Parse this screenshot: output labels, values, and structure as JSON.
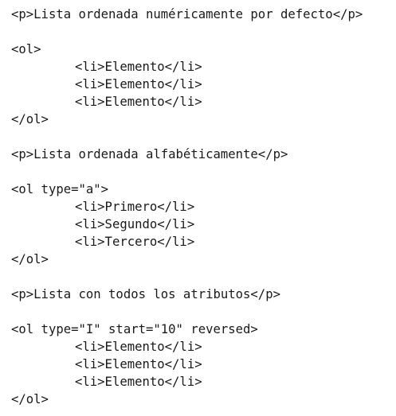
{
  "lines": [
    {
      "text": "<p>Lista ordenada numéricamente por defecto</p>",
      "indent": false
    },
    {
      "text": "",
      "indent": false
    },
    {
      "text": "<ol>",
      "indent": false
    },
    {
      "text": "<li>Elemento</li>",
      "indent": true
    },
    {
      "text": "<li>Elemento</li>",
      "indent": true
    },
    {
      "text": "<li>Elemento</li>",
      "indent": true
    },
    {
      "text": "</ol>",
      "indent": false
    },
    {
      "text": "",
      "indent": false
    },
    {
      "text": "<p>Lista ordenada alfabéticamente</p>",
      "indent": false
    },
    {
      "text": "",
      "indent": false
    },
    {
      "text": "<ol type=\"a\">",
      "indent": false
    },
    {
      "text": "<li>Primero</li>",
      "indent": true
    },
    {
      "text": "<li>Segundo</li>",
      "indent": true
    },
    {
      "text": "<li>Tercero</li>",
      "indent": true
    },
    {
      "text": "</ol>",
      "indent": false
    },
    {
      "text": "",
      "indent": false
    },
    {
      "text": "<p>Lista con todos los atributos</p>",
      "indent": false
    },
    {
      "text": "",
      "indent": false
    },
    {
      "text": "<ol type=\"I\" start=\"10\" reversed>",
      "indent": false
    },
    {
      "text": "<li>Elemento</li>",
      "indent": true
    },
    {
      "text": "<li>Elemento</li>",
      "indent": true
    },
    {
      "text": "<li>Elemento</li>",
      "indent": true
    },
    {
      "text": "</ol>",
      "indent": false
    }
  ]
}
